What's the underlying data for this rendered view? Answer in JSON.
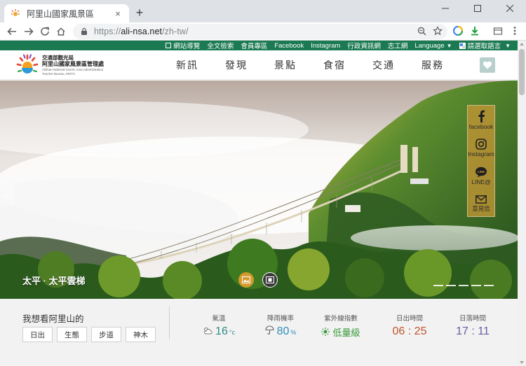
{
  "browser": {
    "tab_title": "阿里山國家風景區",
    "tab_close": "×",
    "new_tab": "+",
    "url_host": "ali-nsa.net",
    "url_path": "/zh-tw/",
    "url_scheme": "https://"
  },
  "utility_links": [
    {
      "label": "網站導覽"
    },
    {
      "label": "全文檢索"
    },
    {
      "label": "會員專區"
    },
    {
      "label": "Facebook"
    },
    {
      "label": "Instagram"
    },
    {
      "label": "行政資訊網"
    },
    {
      "label": "志工網"
    },
    {
      "label": "Language"
    },
    {
      "label": "請選取語言"
    }
  ],
  "logo": {
    "line1": "交通部觀光局",
    "line2": "阿里山國家風景區管理處",
    "line3": "Alishan National Scenic Area Administration",
    "line4": "Tourism Bureau, MOTC"
  },
  "main_nav": [
    {
      "label": "新訊"
    },
    {
      "label": "發現"
    },
    {
      "label": "景點"
    },
    {
      "label": "食宿"
    },
    {
      "label": "交通"
    },
    {
      "label": "服務"
    }
  ],
  "hero": {
    "caption": "太平 · 太平雲梯",
    "dots": 5
  },
  "social": [
    {
      "label": "facebook",
      "icon": "facebook-icon"
    },
    {
      "label": "Instagram",
      "icon": "instagram-icon"
    },
    {
      "label": "LINE@",
      "icon": "line-icon"
    },
    {
      "label": "意見信",
      "icon": "mail-icon"
    }
  ],
  "wish": {
    "title": "我想看阿里山的",
    "tags": [
      "日出",
      "生態",
      "步道",
      "神木"
    ]
  },
  "stats": [
    {
      "label": "氣溫",
      "value": "16",
      "unit": "°c",
      "color": "#2f8a86",
      "icon": "sun-cloud-icon"
    },
    {
      "label": "降雨機率",
      "value": "80",
      "unit": "%",
      "color": "#2f8fb8",
      "icon": "umbrella-icon"
    },
    {
      "label": "紫外線指數",
      "value": "低量級",
      "unit": "",
      "color": "#3a9a3a",
      "icon": "uv-icon"
    },
    {
      "label": "日出時間",
      "value": "06 : 25",
      "unit": "",
      "color": "#c0532c",
      "icon": ""
    },
    {
      "label": "日落時間",
      "value": "17 : 11",
      "unit": "",
      "color": "#6a5aa8",
      "icon": ""
    }
  ],
  "colors": {
    "brand_green": "#1b7a52",
    "social_gold": "#c49634"
  }
}
